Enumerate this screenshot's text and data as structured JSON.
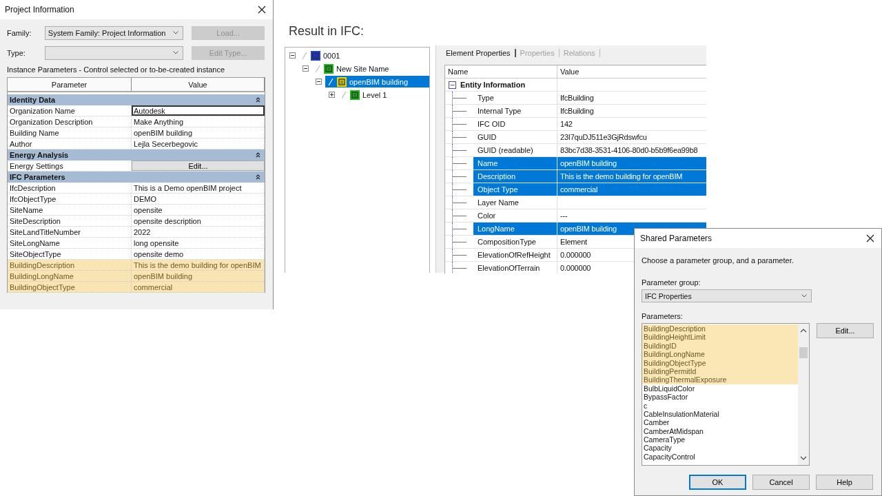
{
  "project_info": {
    "title": "Project Information",
    "family_label": "Family:",
    "family_value": "System Family: Project Information",
    "load_button": "Load...",
    "type_label": "Type:",
    "edit_type_button": "Edit Type...",
    "caption": "Instance Parameters - Control selected or to-be-created instance",
    "columns": [
      "Parameter",
      "Value"
    ],
    "groups": [
      {
        "name": "Identity Data",
        "expanded": true,
        "rows": [
          {
            "kind": "text",
            "parameter": "Organization Name",
            "value": "Autodesk",
            "editing": true,
            "highlighted": false
          },
          {
            "kind": "text",
            "parameter": "Organization Description",
            "value": "Make Anything",
            "editing": false,
            "highlighted": false
          },
          {
            "kind": "text",
            "parameter": "Building Name",
            "value": "openBIM building",
            "editing": false,
            "highlighted": false
          },
          {
            "kind": "text",
            "parameter": "Author",
            "value": "Lejla Secerbegovic",
            "editing": false,
            "highlighted": false
          }
        ]
      },
      {
        "name": "Energy Analysis",
        "expanded": true,
        "rows": [
          {
            "kind": "button",
            "parameter": "Energy Settings",
            "value": "Edit...",
            "highlighted": false
          }
        ]
      },
      {
        "name": "IFC Parameters",
        "expanded": true,
        "rows": [
          {
            "kind": "text",
            "parameter": "IfcDescription",
            "value": "This is a Demo openBIM project",
            "editing": false,
            "highlighted": false
          },
          {
            "kind": "text",
            "parameter": "IfcObjectType",
            "value": "DEMO",
            "editing": false,
            "highlighted": false
          },
          {
            "kind": "text",
            "parameter": "SiteName",
            "value": "opensite",
            "editing": false,
            "highlighted": false
          },
          {
            "kind": "text",
            "parameter": "SiteDescription",
            "value": "opensite description",
            "editing": false,
            "highlighted": false
          },
          {
            "kind": "text",
            "parameter": "SiteLandTitleNumber",
            "value": "2022",
            "editing": false,
            "highlighted": false
          },
          {
            "kind": "text",
            "parameter": "SiteLongName",
            "value": "long opensite",
            "editing": false,
            "highlighted": false
          },
          {
            "kind": "text",
            "parameter": "SiteObjectType",
            "value": "opensite demo",
            "editing": false,
            "highlighted": false
          },
          {
            "kind": "text",
            "parameter": "BuildingDescription",
            "value": "This is the demo building for openBIM",
            "editing": false,
            "highlighted": true
          },
          {
            "kind": "text",
            "parameter": "BuildingLongName",
            "value": "openBIM building",
            "editing": false,
            "highlighted": true
          },
          {
            "kind": "text",
            "parameter": "BuildingObjectType",
            "value": "commercial",
            "editing": false,
            "highlighted": true
          }
        ]
      }
    ]
  },
  "result_heading": "Result in IFC:",
  "ifc_tree": [
    {
      "label": "0001",
      "kind": "project",
      "expanded": true,
      "selected": false,
      "children": [
        {
          "label": "New Site Name",
          "kind": "site",
          "expanded": true,
          "selected": false,
          "children": [
            {
              "label": "openBIM building",
              "kind": "building",
              "expanded": true,
              "selected": true,
              "children": [
                {
                  "label": "Level 1",
                  "kind": "storey",
                  "expanded": false,
                  "selected": false
                }
              ]
            }
          ]
        }
      ]
    }
  ],
  "element_properties": {
    "tabs": [
      {
        "label": "Element Properties",
        "selected": true
      },
      {
        "label": "Properties",
        "selected": false
      },
      {
        "label": "Relations",
        "selected": false
      }
    ],
    "columns": [
      "Name",
      "Value"
    ],
    "groups": [
      {
        "name": "Entity Information",
        "expanded": true,
        "rows": [
          {
            "name": "Type",
            "value": "IfcBuilding",
            "selected": false
          },
          {
            "name": "Internal Type",
            "value": "IfcBuilding",
            "selected": false
          },
          {
            "name": "IFC OID",
            "value": "142",
            "selected": false
          },
          {
            "name": "GUID",
            "value": "23I7quDJ511e3GjRdswfcu",
            "selected": false
          },
          {
            "name": "GUID (readable)",
            "value": "83bc7d38-3531-4106-80d0-b5b9f6ea99b8",
            "selected": false
          },
          {
            "name": "Name",
            "value": "openBIM building",
            "selected": true
          },
          {
            "name": "Description",
            "value": "This is the demo building for openBIM",
            "selected": true
          },
          {
            "name": "Object Type",
            "value": "commercial",
            "selected": true
          },
          {
            "name": "Layer Name",
            "selected": false
          },
          {
            "name": "Color",
            "value": "---",
            "selected": false
          },
          {
            "name": "LongName",
            "value": "openBIM building",
            "selected": true
          },
          {
            "name": "CompositionType",
            "value": "Element",
            "selected": false
          },
          {
            "name": "ElevationOfRefHeight",
            "value": "0.000000",
            "selected": false
          },
          {
            "name": "ElevationOfTerrain",
            "value": "0.000000",
            "selected": false
          }
        ]
      }
    ]
  },
  "shared_parameters": {
    "title": "Shared Parameters",
    "instruction": "Choose a parameter group, and a parameter.",
    "group_label": "Parameter group:",
    "group_value": "IFC Properties",
    "parameters_label": "Parameters:",
    "edit_button": "Edit...",
    "parameters": [
      {
        "label": "BuildingDescription",
        "selected": true
      },
      {
        "label": "BuildingHeightLimit",
        "selected": true
      },
      {
        "label": "BuildingID",
        "selected": true
      },
      {
        "label": "BuildingLongName",
        "selected": true
      },
      {
        "label": "BuildingObjectType",
        "selected": true
      },
      {
        "label": "BuildingPermitId",
        "selected": true
      },
      {
        "label": "BuildingThermalExposure",
        "selected": true
      },
      {
        "label": "BulbLiquidColor",
        "selected": false
      },
      {
        "label": "BypassFactor",
        "selected": false
      },
      {
        "label": "c",
        "selected": false
      },
      {
        "label": "CableInsulationMaterial",
        "selected": false
      },
      {
        "label": "Camber",
        "selected": false
      },
      {
        "label": "CamberAtMidspan",
        "selected": false
      },
      {
        "label": "CameraType",
        "selected": false
      },
      {
        "label": "Capacity",
        "selected": false
      },
      {
        "label": "CapacityControl",
        "selected": false
      }
    ],
    "buttons": [
      "OK",
      "Cancel",
      "Help"
    ]
  }
}
